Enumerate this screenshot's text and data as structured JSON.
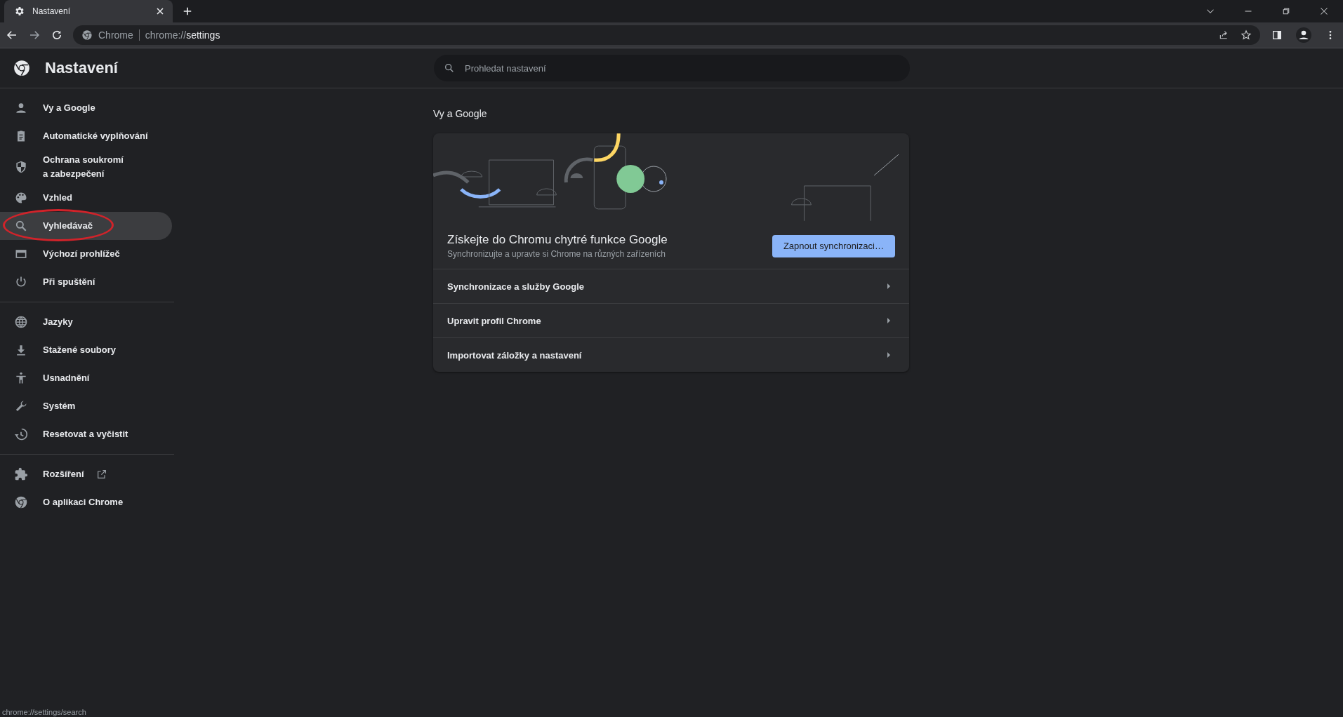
{
  "browser": {
    "tab": {
      "title": "Nastavení"
    },
    "address": {
      "site": "Chrome",
      "url_prefix": "chrome://",
      "url_path": "settings"
    }
  },
  "header": {
    "title": "Nastavení",
    "search": {
      "placeholder": "Prohledat nastavení"
    }
  },
  "sidebar": {
    "groups": [
      [
        {
          "label": "Vy a Google",
          "selected": false,
          "circled": false
        },
        {
          "label": "Automatické vyplňování",
          "selected": false,
          "circled": false
        },
        {
          "label": "Ochrana soukromí\na zabezpečení",
          "selected": false,
          "circled": false
        },
        {
          "label": "Vzhled",
          "selected": false,
          "circled": false
        },
        {
          "label": "Vyhledávač",
          "selected": true,
          "circled": true
        },
        {
          "label": "Výchozí prohlížeč",
          "selected": false,
          "circled": false
        },
        {
          "label": "Při spuštění",
          "selected": false,
          "circled": false
        }
      ],
      [
        {
          "label": "Jazyky",
          "selected": false,
          "circled": false
        },
        {
          "label": "Stažené soubory",
          "selected": false,
          "circled": false
        },
        {
          "label": "Usnadnění",
          "selected": false,
          "circled": false
        },
        {
          "label": "Systém",
          "selected": false,
          "circled": false
        },
        {
          "label": "Resetovat a vyčistit",
          "selected": false,
          "circled": false
        }
      ],
      [
        {
          "label": "Rozšíření",
          "selected": false,
          "circled": false,
          "external": true
        },
        {
          "label": "O aplikaci Chrome",
          "selected": false,
          "circled": false,
          "external": false
        }
      ]
    ]
  },
  "section": {
    "title": "Vy a Google",
    "promo": {
      "title": "Získejte do Chromu chytré funkce Google",
      "subtitle": "Synchronizujte a upravte si Chrome na různých zařízeních",
      "button": "Zapnout synchronizaci…"
    },
    "rows": [
      "Synchronizace a služby Google",
      "Upravit profil Chrome",
      "Importovat záložky a nastavení"
    ]
  },
  "status_bar": {
    "url": "chrome://settings/search"
  }
}
